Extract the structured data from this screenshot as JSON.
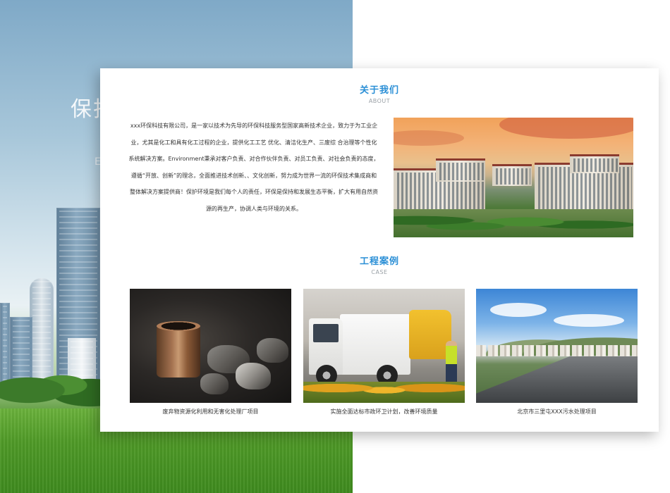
{
  "hero": {
    "title_partial": "保护",
    "subtitle_partial": "E"
  },
  "about": {
    "title": "关于我们",
    "subtitle": "ABOUT",
    "text_lines": [
      "xxx环保科技有限公司，是一家以技术为先导的环保科技服务型国家高新技术企业，致力于为工业企",
      "业，尤其是化工和具有化工过程的企业，提供化工工艺 优化、清洁化生产、三废综 合治理等个性化",
      "系统解决方案。Environment秉承对客户负责、对合作伙伴负责、对员工负责、对社会负责的态度，",
      "遵循“开放、创新”的理念，全面推进技术创新、、文化创新，努力成为世界一流的环保技术集成商和",
      "整体解决方案提供商！保护环境是我们每个人的责任，环保是保持和发展生态平衡，扩大有用自然资",
      "源的再生产，协调人类与环境的关系。"
    ],
    "image_icon": "residential-complex-photo"
  },
  "cases": {
    "title": "工程案例",
    "subtitle": "CASE",
    "items": [
      {
        "caption": "废弃物资源化利用和无害化处理厂项目",
        "image_icon": "rusty-can-waste-photo"
      },
      {
        "caption": "实施全面达标市政环卫计划，改善环境质量",
        "image_icon": "garbage-truck-photo"
      },
      {
        "caption": "北京市三里屯XXX污水处理项目",
        "image_icon": "highway-landscape-photo"
      }
    ]
  },
  "colors": {
    "accent": "#2b8fd6",
    "text": "#333333",
    "muted": "#9aa0a6"
  }
}
